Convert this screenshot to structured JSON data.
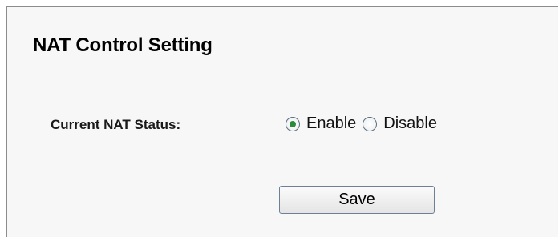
{
  "page": {
    "title": "NAT Control Setting"
  },
  "nat_status": {
    "label": "Current NAT Status:",
    "options": [
      {
        "label": "Enable",
        "selected": true
      },
      {
        "label": "Disable",
        "selected": false
      }
    ]
  },
  "actions": {
    "save_label": "Save"
  },
  "colors": {
    "panel_background": "#f7f7f7",
    "radio_selected_dot": "#2c8a3c",
    "button_border": "#6f7f95"
  }
}
